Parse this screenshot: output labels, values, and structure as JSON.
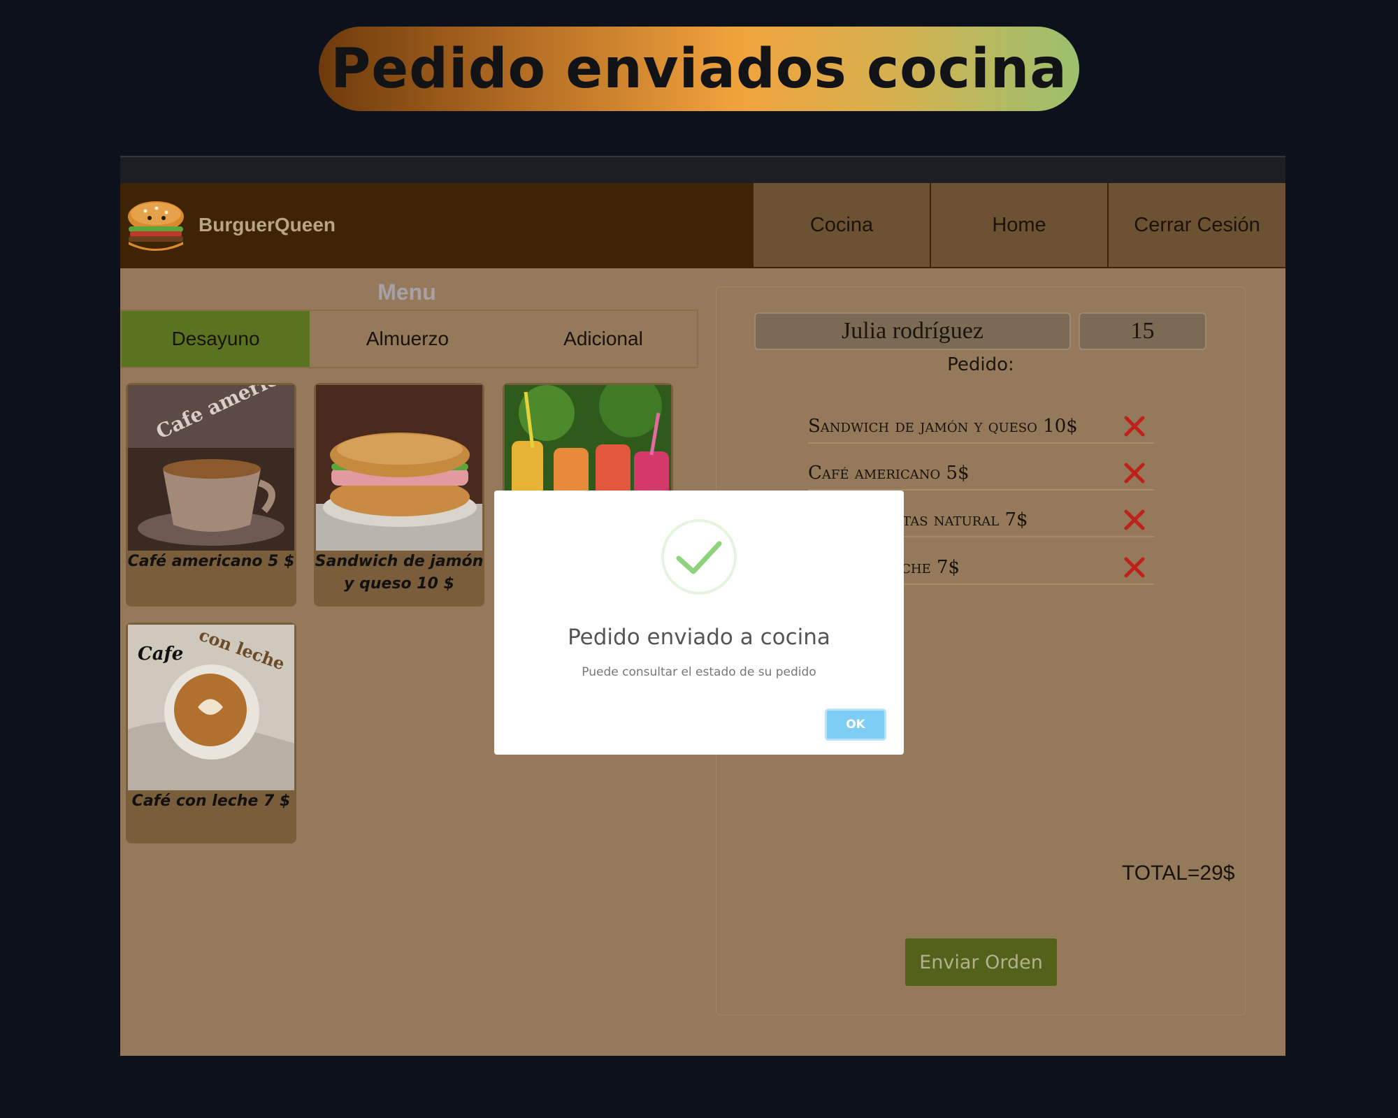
{
  "banner": {
    "title": "Pedido enviados cocina"
  },
  "navbar": {
    "brand": "BurguerQueen",
    "logo_icon": "burger-logo-icon",
    "links": [
      "Cocina",
      "Home",
      "Cerrar Cesión"
    ]
  },
  "menu": {
    "title": "Menu",
    "tabs": [
      {
        "label": "Desayuno",
        "active": true
      },
      {
        "label": "Almuerzo",
        "active": false
      },
      {
        "label": "Adicional",
        "active": false
      }
    ],
    "cards": [
      {
        "label": "Café americano 5 $",
        "image_overlay": "Cafe americano"
      },
      {
        "label": "Sandwich de jamón y queso 10 $"
      },
      {
        "label": ""
      },
      {
        "label": "Café con leche 7 $",
        "image_overlay_1": "Cafe",
        "image_overlay_2": "con leche"
      }
    ]
  },
  "order": {
    "client_name": "Julia rodríguez",
    "table_number": "15",
    "label": "Pedido:",
    "items": [
      "Sandwich de jamón y queso 10$",
      "Café americano 5$",
      "utas natural 7$",
      "eche 7$"
    ],
    "total": "TOTAL=29$",
    "send_button": "Enviar Orden"
  },
  "modal": {
    "title": "Pedido enviado a cocina",
    "subtitle": "Puede consultar el estado de su pedido",
    "ok_button": "OK"
  },
  "colors": {
    "navbar_bg": "#3e2405",
    "content_bg": "#94795a",
    "active_tab": "#5a7320",
    "send_button": "#52621a",
    "ok_button": "#7ecdf4",
    "delete_icon": "#c0201a"
  }
}
